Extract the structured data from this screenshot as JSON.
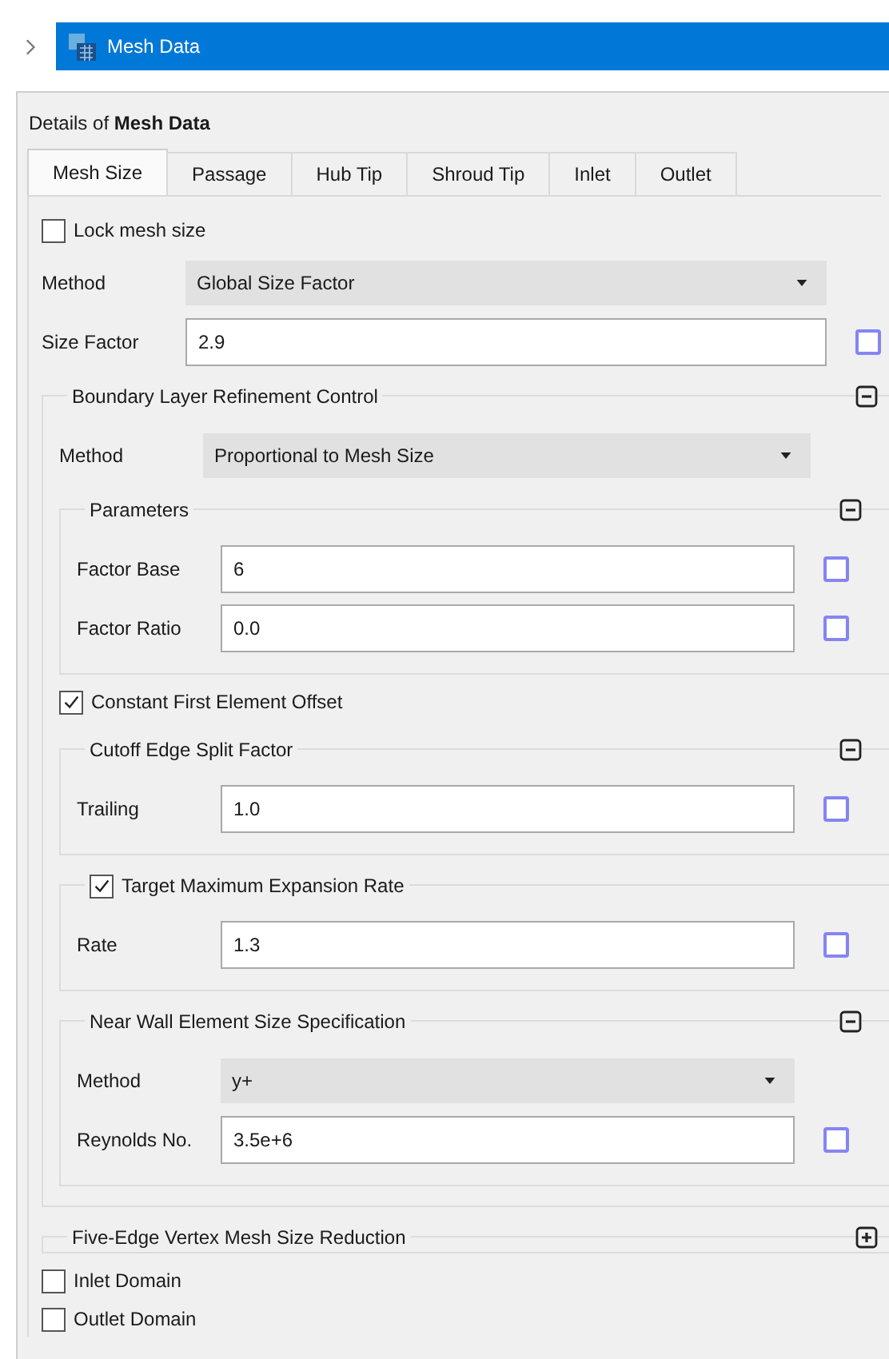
{
  "tree": {
    "items": [
      {
        "label": "Mesh Data",
        "selected": true
      }
    ]
  },
  "details": {
    "title": "Details of **Mesh Data**"
  },
  "tabs": [
    {
      "label": "Mesh Size",
      "selected": true
    },
    {
      "label": "Passage",
      "selected": false
    },
    {
      "label": "Hub Tip",
      "selected": false
    },
    {
      "label": "Shroud Tip",
      "selected": false
    },
    {
      "label": "Inlet",
      "selected": false
    },
    {
      "label": "Outlet",
      "selected": false
    }
  ],
  "items": [
    {
      "kind": "checkbox",
      "label": "Lock mesh size",
      "checked": false
    },
    {
      "kind": "dropdown",
      "label": "Method",
      "value": "Global Size Factor"
    },
    {
      "kind": "field",
      "label": "Size Factor",
      "value": "2.9",
      "parameter": false
    },
    {
      "kind": "group",
      "title": "Boundary Layer Refinement Control",
      "expanded": true,
      "children": [
        {
          "kind": "dropdown",
          "label": "Method",
          "value": "Proportional to Mesh Size"
        },
        {
          "kind": "group",
          "title": "Parameters",
          "expanded": true,
          "children": [
            {
              "kind": "field",
              "label": "Factor Base",
              "value": "6",
              "parameter": false
            },
            {
              "kind": "field",
              "label": "Factor Ratio",
              "value": "0.0",
              "parameter": false
            }
          ]
        },
        {
          "kind": "checkbox",
          "label": "Constant First Element Offset",
          "checked": true
        },
        {
          "kind": "group",
          "title": "Cutoff Edge Split Factor",
          "expanded": true,
          "children": [
            {
              "kind": "field",
              "label": "Trailing",
              "value": "1.0",
              "parameter": false
            }
          ]
        },
        {
          "kind": "checkgroup",
          "title": "Target Maximum Expansion Rate",
          "checked": true,
          "children": [
            {
              "kind": "field",
              "label": "Rate",
              "value": "1.3",
              "parameter": false
            }
          ]
        },
        {
          "kind": "group",
          "title": "Near Wall Element Size Specification",
          "expanded": true,
          "children": [
            {
              "kind": "dropdown",
              "label": "Method",
              "value": "y+"
            },
            {
              "kind": "field",
              "label": "Reynolds No.",
              "value": "3.5e+6",
              "parameter": false
            }
          ]
        }
      ]
    },
    {
      "kind": "group",
      "title": "Five-Edge Vertex Mesh Size Reduction",
      "expanded": false
    },
    {
      "kind": "checkbox",
      "label": "Inlet Domain",
      "checked": false
    },
    {
      "kind": "checkbox",
      "label": "Outlet Domain",
      "checked": false
    }
  ]
}
